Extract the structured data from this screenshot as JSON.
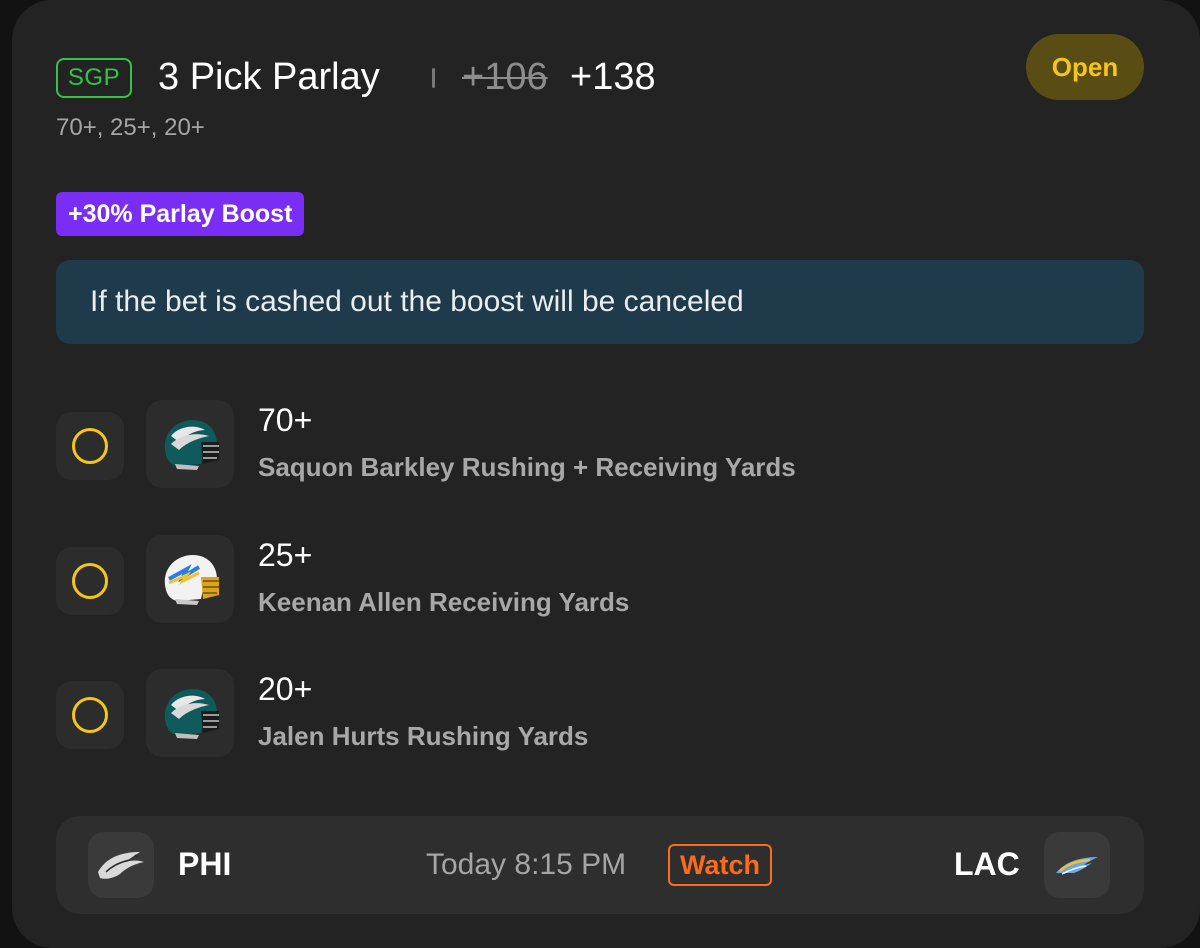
{
  "header": {
    "badge": "SGP",
    "title": "3 Pick Parlay",
    "old_odds": "+106",
    "new_odds": "+138",
    "subtitle": "70+, 25+, 20+",
    "status": "Open"
  },
  "boost": {
    "label": "+30% Parlay Boost"
  },
  "notice": {
    "text": "If the bet is cashed out the boost will be canceled"
  },
  "legs": [
    {
      "line": "70+",
      "market": "Saquon Barkley Rushing + Receiving Yards",
      "team": "eagles"
    },
    {
      "line": "25+",
      "market": "Keenan Allen Receiving Yards",
      "team": "chargers"
    },
    {
      "line": "20+",
      "market": "Jalen Hurts Rushing Yards",
      "team": "eagles"
    }
  ],
  "game": {
    "home": "PHI",
    "away": "LAC",
    "time": "Today 8:15 PM",
    "watch": "Watch"
  },
  "colors": {
    "accent_green": "#34c24a",
    "accent_yellow": "#f4c51c",
    "boost_purple": "#7a2df5",
    "watch_orange": "#ff6a1a",
    "notice_bg": "#1f3a4a"
  }
}
